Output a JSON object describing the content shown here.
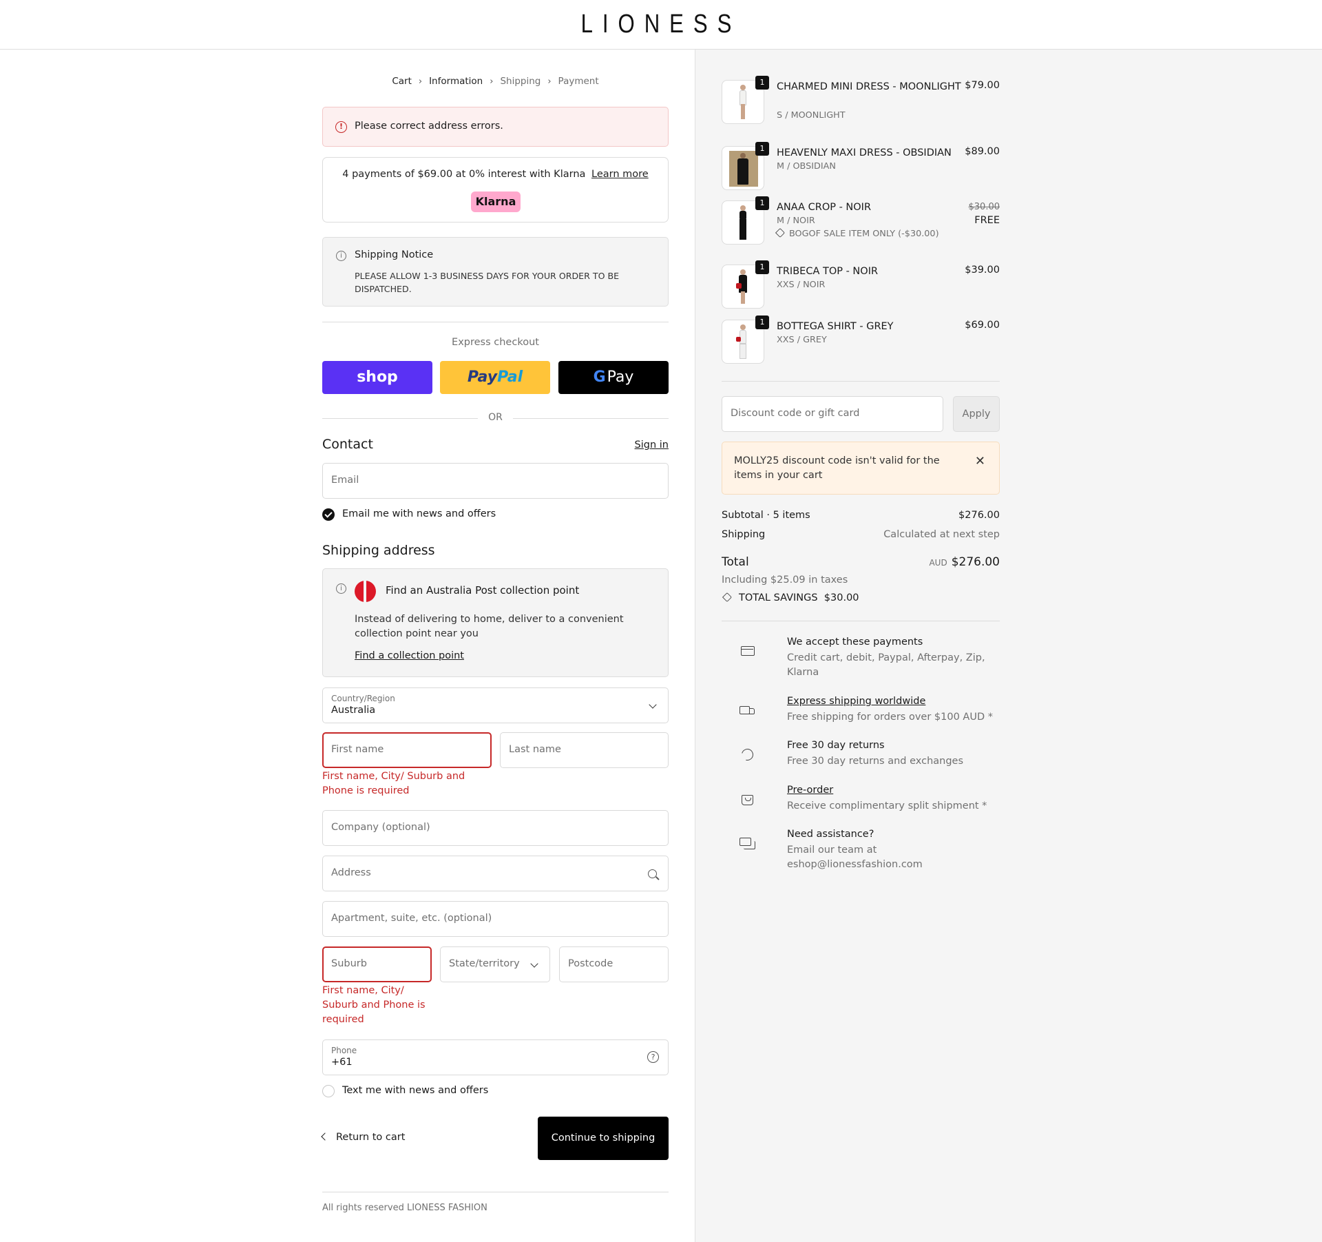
{
  "brand": "LIONESS",
  "breadcrumb": {
    "cart": "Cart",
    "information": "Information",
    "shipping": "Shipping",
    "payment": "Payment",
    "sep": "›"
  },
  "error_alert": "Please correct address errors.",
  "klarna": {
    "text": "4 payments of $69.00 at 0% interest with Klarna",
    "link": "Learn more",
    "badge": "Klarna"
  },
  "shipping_notice": {
    "title": "Shipping Notice",
    "body": "PLEASE ALLOW 1-3 BUSINESS DAYS FOR YOUR ORDER TO BE DISPATCHED."
  },
  "express": {
    "label": "Express checkout",
    "shop": "shop",
    "paypal_a": "Pay",
    "paypal_b": "Pal",
    "gpay_g": "G",
    "gpay": "Pay",
    "or": "OR"
  },
  "contact": {
    "title": "Contact",
    "signin": "Sign in",
    "email_placeholder": "Email",
    "email_news": "Email me with news and offers",
    "email_news_checked": true
  },
  "shipping_address": {
    "title": "Shipping address",
    "ap": {
      "title": "Find an Australia Post collection point",
      "body": "Instead of delivering to home, deliver to a convenient collection point near you",
      "link": "Find a collection point"
    },
    "country_label": "Country/Region",
    "country_value": "Australia",
    "first_name": "First name",
    "last_name": "Last name",
    "name_error": "First name, City/ Suburb and Phone is required",
    "company": "Company (optional)",
    "address": "Address",
    "apartment": "Apartment, suite, etc. (optional)",
    "suburb": "Suburb",
    "state": "State/territory",
    "postcode": "Postcode",
    "suburb_error": "First name, City/ Suburb and Phone is required",
    "phone_label": "Phone",
    "phone_value": "+61",
    "text_news": "Text me with news and offers",
    "text_news_checked": false
  },
  "actions": {
    "back": "Return to cart",
    "continue": "Continue to shipping"
  },
  "footer": "All rights reserved LIONESS FASHION",
  "cart": {
    "items": [
      {
        "qty": "1",
        "name": "CHARMED MINI DRESS - MOONLIGHT",
        "variant": "S / MOONLIGHT",
        "price": "$79.00",
        "fig_color": "#f2f2f0"
      },
      {
        "qty": "1",
        "name": "HEAVENLY MAXI DRESS - OBSIDIAN",
        "variant": "M / OBSIDIAN",
        "price": "$89.00",
        "fig_color": "#141414"
      },
      {
        "qty": "1",
        "name": "ANAA CROP - NOIR",
        "variant": "M / NOIR",
        "price_original": "$30.00",
        "price": "FREE",
        "promo": "BOGOF SALE ITEM ONLY (-$30.00)",
        "fig_color": "#111111"
      },
      {
        "qty": "1",
        "name": "TRIBECA TOP - NOIR",
        "variant": "XXS / NOIR",
        "price": "$39.00",
        "fig_color": "#111111"
      },
      {
        "qty": "1",
        "name": "BOTTEGA SHIRT - GREY",
        "variant": "XXS / GREY",
        "price": "$69.00",
        "fig_color": "#f0f0f0"
      }
    ],
    "discount_placeholder": "Discount code or gift card",
    "apply": "Apply",
    "discount_warning": "MOLLY25 discount code isn't valid for the items in your cart",
    "close": "✕",
    "subtotal_label": "Subtotal · 5 items",
    "subtotal": "$276.00",
    "shipping_label": "Shipping",
    "shipping_value": "Calculated at next step",
    "total_label": "Total",
    "currency": "AUD",
    "total": "$276.00",
    "taxes": "Including $25.09 in taxes",
    "savings_label": "TOTAL SAVINGS",
    "savings": "$30.00"
  },
  "features": [
    {
      "icon": "credit-card-icon",
      "title": "We accept these payments",
      "desc": "Credit cart, debit, Paypal, Afterpay, Zip, Klarna",
      "link": false
    },
    {
      "icon": "truck-icon",
      "title": "Express shipping worldwide",
      "desc": "Free shipping for orders over $100 AUD *",
      "link": true
    },
    {
      "icon": "returns-icon",
      "title": "Free 30 day returns",
      "desc": "Free 30 day returns and exchanges",
      "link": false
    },
    {
      "icon": "bag-icon",
      "title": "Pre-order",
      "desc": "Receive complimentary split shipment *",
      "link": true
    },
    {
      "icon": "chat-icon",
      "title": "Need assistance?",
      "desc": "Email our team at eshop@lionessfashion.com",
      "link": false
    }
  ],
  "colors": {
    "error": "#c62828",
    "shop_pay": "#5a31f4",
    "paypal": "#ffc439",
    "klarna": "#ffa8cd",
    "australia_post": "#dc1928"
  }
}
